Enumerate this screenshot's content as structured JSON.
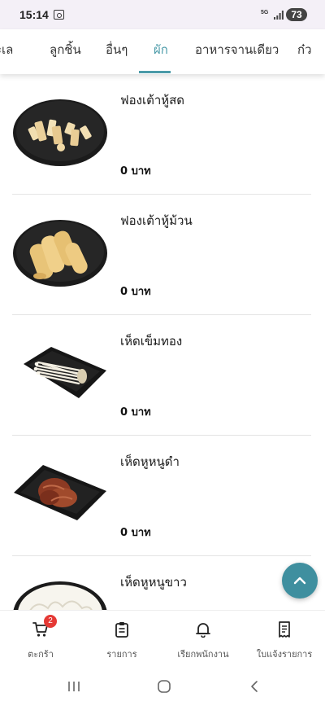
{
  "status_bar": {
    "time": "15:14",
    "network": "5G",
    "battery": "73"
  },
  "tabs": [
    {
      "label": "ะเล",
      "active": false
    },
    {
      "label": "ลูกชิ้น",
      "active": false
    },
    {
      "label": "อื่นๆ",
      "active": false
    },
    {
      "label": "ผัก",
      "active": true
    },
    {
      "label": "อาหารจานเดียว",
      "active": false
    },
    {
      "label": "ก๋ว",
      "active": false
    }
  ],
  "products": [
    {
      "name": "ฟองเต้าหู้สด",
      "price": "0 บาท",
      "image_icon": "fresh-tofu-skin-plate"
    },
    {
      "name": "ฟองเต้าหู้ม้วน",
      "price": "0 บาท",
      "image_icon": "rolled-tofu-skin-plate"
    },
    {
      "name": "เห็ดเข็มทอง",
      "price": "0 บาท",
      "image_icon": "enoki-mushroom-plate"
    },
    {
      "name": "เห็ดหูหนูดำ",
      "price": "0 บาท",
      "image_icon": "black-fungus-plate"
    },
    {
      "name": "เห็ดหูหนูขาว",
      "price": "",
      "image_icon": "white-fungus-plate"
    }
  ],
  "bottom_nav": [
    {
      "label": "ตะกร้า",
      "icon": "cart-icon",
      "badge": "2"
    },
    {
      "label": "รายการ",
      "icon": "clipboard-icon"
    },
    {
      "label": "เรียกพนักงาน",
      "icon": "bell-icon"
    },
    {
      "label": "ใบแจ้งรายการ",
      "icon": "receipt-icon"
    }
  ],
  "colors": {
    "accent": "#4a9aa8",
    "scroll_button": "#3f8f9f",
    "badge": "#e53935",
    "plate": "#1b1b1b"
  }
}
